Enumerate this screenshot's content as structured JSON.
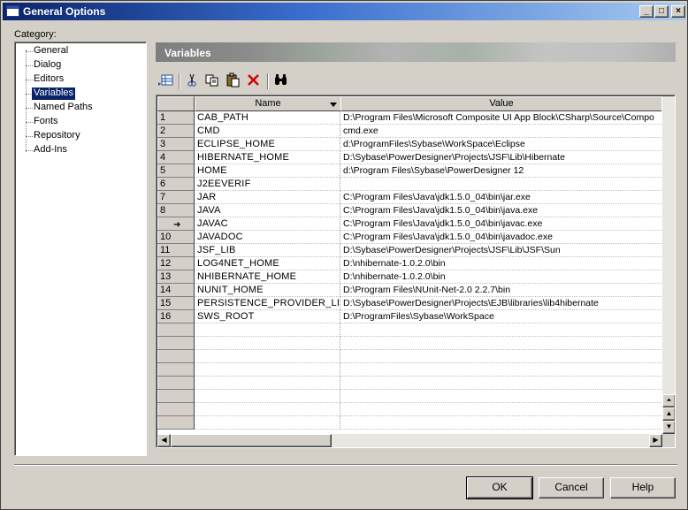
{
  "window": {
    "title": "General Options",
    "caption_buttons": {
      "minimize": "_",
      "maximize": "□",
      "close": "×"
    }
  },
  "category": {
    "label": "Category:",
    "items": [
      {
        "label": "General",
        "selected": false
      },
      {
        "label": "Dialog",
        "selected": false
      },
      {
        "label": "Editors",
        "selected": false
      },
      {
        "label": "Variables",
        "selected": true
      },
      {
        "label": "Named Paths",
        "selected": false
      },
      {
        "label": "Fonts",
        "selected": false
      },
      {
        "label": "Repository",
        "selected": false
      },
      {
        "label": "Add-Ins",
        "selected": false
      }
    ]
  },
  "panel": {
    "title": "Variables"
  },
  "toolbar": {
    "icons": [
      "add-rows-icon",
      "cut-icon",
      "copy-icon",
      "paste-icon",
      "delete-icon",
      "find-icon"
    ]
  },
  "grid": {
    "columns": {
      "name": "Name",
      "value": "Value"
    },
    "current_row_marker": "➜",
    "rows": [
      {
        "num": "1",
        "name": "CAB_PATH",
        "value": "D:\\Program Files\\Microsoft Composite UI App Block\\CSharp\\Source\\Compo"
      },
      {
        "num": "2",
        "name": "CMD",
        "value": "cmd.exe"
      },
      {
        "num": "3",
        "name": "ECLIPSE_HOME",
        "value": "d:\\ProgramFiles\\Sybase\\WorkSpace\\Eclipse"
      },
      {
        "num": "4",
        "name": "HIBERNATE_HOME",
        "value": "D:\\Sybase\\PowerDesigner\\Projects\\JSF\\Lib\\Hibernate"
      },
      {
        "num": "5",
        "name": "HOME",
        "value": "d:\\Program Files\\Sybase\\PowerDesigner 12"
      },
      {
        "num": "6",
        "name": "J2EEVERIF",
        "value": ""
      },
      {
        "num": "7",
        "name": "JAR",
        "value": "C:\\Program Files\\Java\\jdk1.5.0_04\\bin\\jar.exe"
      },
      {
        "num": "8",
        "name": "JAVA",
        "value": "C:\\Program Files\\Java\\jdk1.5.0_04\\bin\\java.exe"
      },
      {
        "num": "",
        "name": "JAVAC",
        "value": "C:\\Program Files\\Java\\jdk1.5.0_04\\bin\\javac.exe"
      },
      {
        "num": "10",
        "name": "JAVADOC",
        "value": "C:\\Program Files\\Java\\jdk1.5.0_04\\bin\\javadoc.exe"
      },
      {
        "num": "11",
        "name": "JSF_LIB",
        "value": "D:\\Sybase\\PowerDesigner\\Projects\\JSF\\Lib\\JSF\\Sun"
      },
      {
        "num": "12",
        "name": "LOG4NET_HOME",
        "value": "D:\\nhibernate-1.0.2.0\\bin"
      },
      {
        "num": "13",
        "name": "NHIBERNATE_HOME",
        "value": "D:\\nhibernate-1.0.2.0\\bin"
      },
      {
        "num": "14",
        "name": "NUNIT_HOME",
        "value": "D:\\Program Files\\NUnit-Net-2.0 2.2.7\\bin"
      },
      {
        "num": "15",
        "name": "PERSISTENCE_PROVIDER_LIB",
        "value": "D:\\Sybase\\PowerDesigner\\Projects\\EJB\\libraries\\lib4hibernate"
      },
      {
        "num": "16",
        "name": "SWS_ROOT",
        "value": "D:\\ProgramFiles\\Sybase\\WorkSpace"
      }
    ],
    "empty_rows": 8
  },
  "buttons": {
    "ok": "OK",
    "cancel": "Cancel",
    "help": "Help"
  }
}
